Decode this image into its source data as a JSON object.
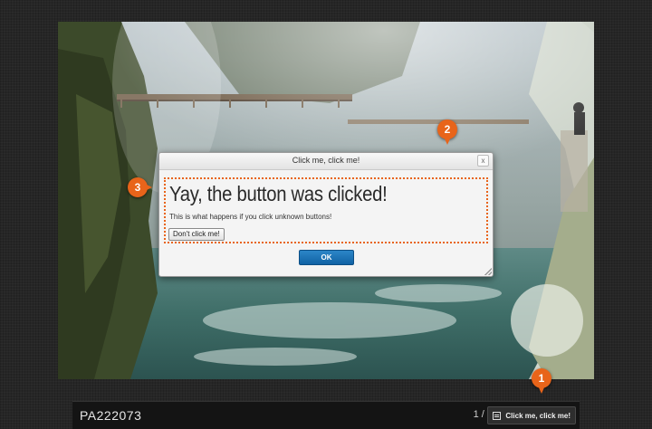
{
  "lightbox": {
    "caption_title": "PA222073",
    "counter": "1 / 3",
    "caption_button_label": "Click me, click me!"
  },
  "dialog": {
    "title": "Click me, click me!",
    "close_label": "x",
    "heading": "Yay, the button was clicked!",
    "text": "This is what happens if you click unknown buttons!",
    "dont_button_label": "Don't click me!",
    "ok_label": "OK"
  },
  "markers": {
    "m1": "1",
    "m2": "2",
    "m3": "3"
  },
  "colors": {
    "accent": "#e8641a",
    "ok_button": "#1a6fb3"
  }
}
